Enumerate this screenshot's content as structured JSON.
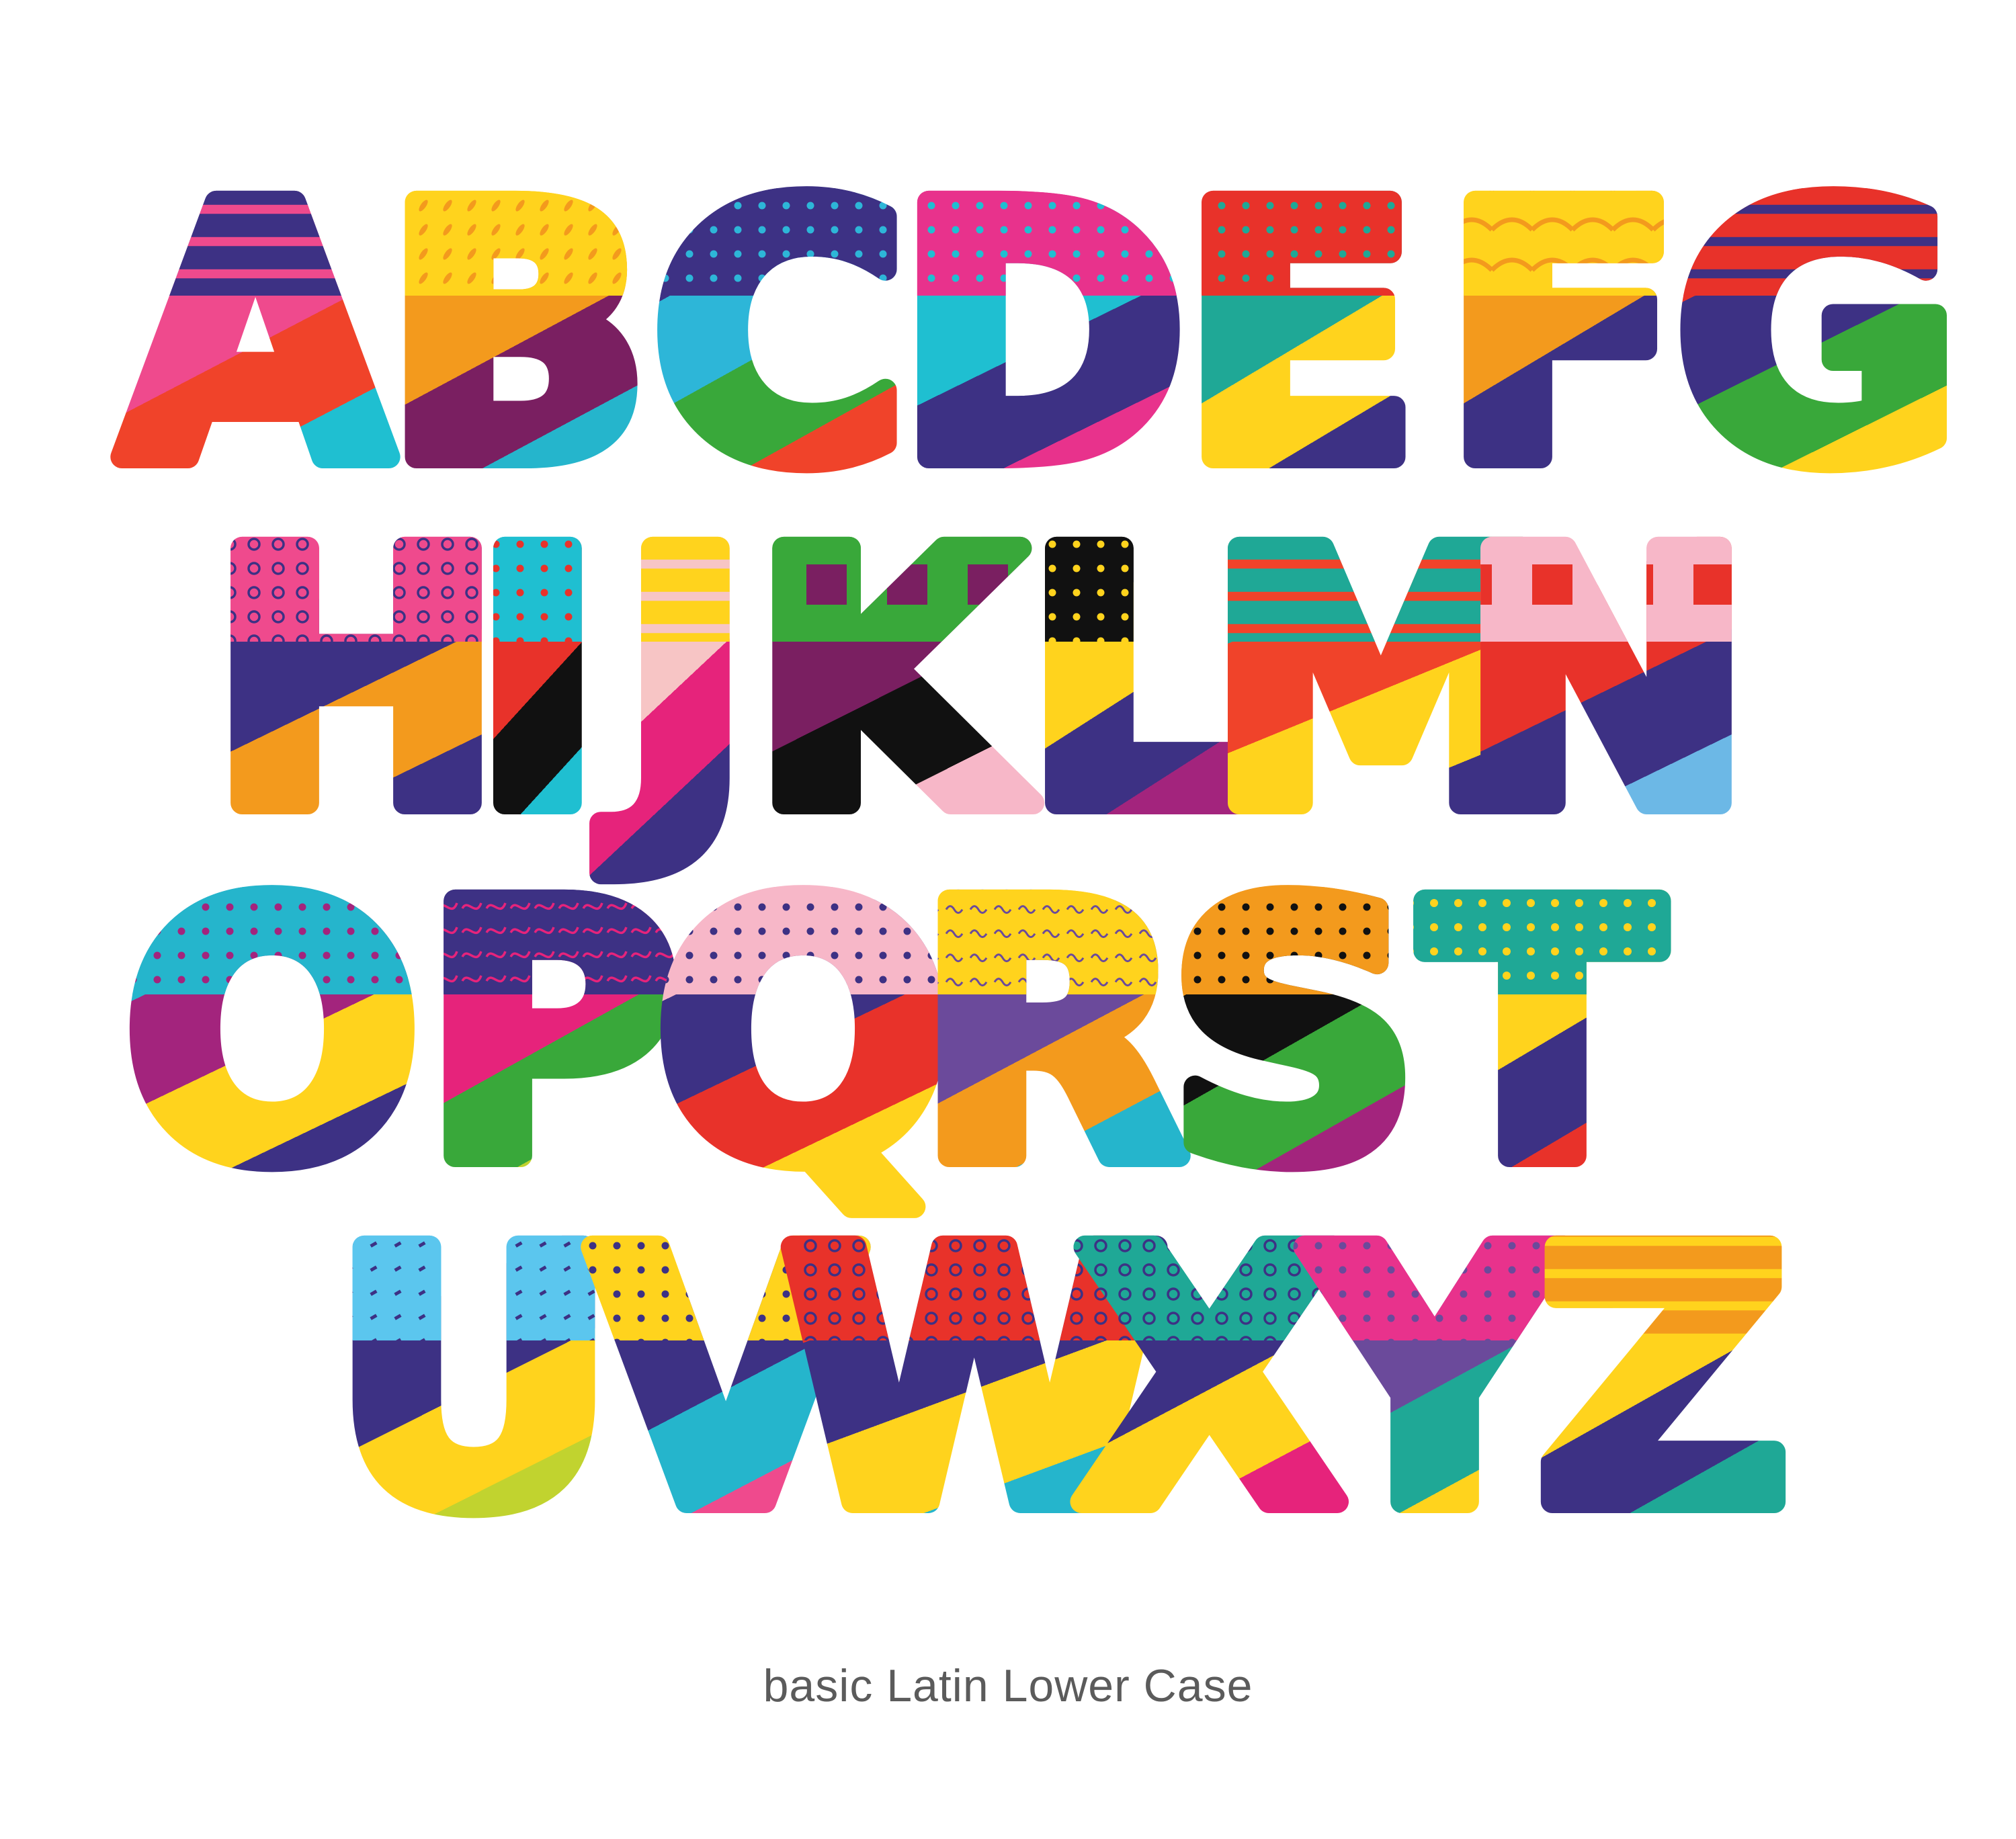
{
  "alphabet": [
    {
      "letter": "A",
      "colors": [
        "#3d3184",
        "#ef4a8d",
        "#f0432a",
        "#1fbfd1"
      ],
      "pattern": "stripes"
    },
    {
      "letter": "B",
      "colors": [
        "#ffd31d",
        "#f39a1d",
        "#7a1f61",
        "#25b5cc"
      ],
      "pattern": "leaves"
    },
    {
      "letter": "C",
      "colors": [
        "#3d3184",
        "#2db6d8",
        "#39a83a",
        "#f0432a"
      ],
      "pattern": "dots"
    },
    {
      "letter": "D",
      "colors": [
        "#e8328c",
        "#1fbfd1",
        "#3d3184",
        "#e8328c"
      ],
      "pattern": "dots"
    },
    {
      "letter": "E",
      "colors": [
        "#e8322a",
        "#1fa896",
        "#ffd31d",
        "#3d3184"
      ],
      "pattern": "dots"
    },
    {
      "letter": "F",
      "colors": [
        "#ffd31d",
        "#f39a1d",
        "#3d3184",
        "#3d3184"
      ],
      "pattern": "arcs"
    },
    {
      "letter": "G",
      "colors": [
        "#e8322a",
        "#3d3184",
        "#39a83a",
        "#ffd31d"
      ],
      "pattern": "stripes"
    },
    {
      "letter": "H",
      "colors": [
        "#ef4a8d",
        "#3d3184",
        "#f39a1d",
        "#3d3184"
      ],
      "pattern": "rings"
    },
    {
      "letter": "I",
      "colors": [
        "#1fbfd1",
        "#e8322a",
        "#111111",
        "#1fbfd1"
      ],
      "pattern": "dots"
    },
    {
      "letter": "J",
      "colors": [
        "#ffd31d",
        "#f7c5c5",
        "#e6237b",
        "#3d3184"
      ],
      "pattern": "stripes"
    },
    {
      "letter": "K",
      "colors": [
        "#39a83a",
        "#7a1f61",
        "#111111",
        "#f7b7c8"
      ],
      "pattern": "blocks"
    },
    {
      "letter": "L",
      "colors": [
        "#111111",
        "#ffd31d",
        "#3d3184",
        "#a3247d"
      ],
      "pattern": "dots"
    },
    {
      "letter": "M",
      "colors": [
        "#1fa896",
        "#f0432a",
        "#ffd31d",
        "#3d3184"
      ],
      "pattern": "stripes"
    },
    {
      "letter": "N",
      "colors": [
        "#f7b7c8",
        "#e8322a",
        "#3d3184",
        "#6cb8e6"
      ],
      "pattern": "blocks"
    },
    {
      "letter": "O",
      "colors": [
        "#25b5cc",
        "#a3247d",
        "#ffd31d",
        "#3d3184"
      ],
      "pattern": "dots"
    },
    {
      "letter": "P",
      "colors": [
        "#3d3184",
        "#e6237b",
        "#39a83a",
        "#c1d32f"
      ],
      "pattern": "scribble"
    },
    {
      "letter": "Q",
      "colors": [
        "#f7b7c8",
        "#3d3184",
        "#e8322a",
        "#ffd31d"
      ],
      "pattern": "dots"
    },
    {
      "letter": "R",
      "colors": [
        "#ffd31d",
        "#6b4a9b",
        "#f39a1d",
        "#25b5cc"
      ],
      "pattern": "squiggles"
    },
    {
      "letter": "S",
      "colors": [
        "#f39a1d",
        "#111111",
        "#39a83a",
        "#a3247d"
      ],
      "pattern": "dots"
    },
    {
      "letter": "T",
      "colors": [
        "#1fa896",
        "#ffd31d",
        "#3d3184",
        "#e8322a"
      ],
      "pattern": "blobs"
    },
    {
      "letter": "U",
      "colors": [
        "#5bc6ee",
        "#3d3184",
        "#ffd31d",
        "#c1d32f"
      ],
      "pattern": "dashes"
    },
    {
      "letter": "V",
      "colors": [
        "#ffd31d",
        "#3d3184",
        "#25b5cc",
        "#ef4a8d"
      ],
      "pattern": "dots"
    },
    {
      "letter": "W",
      "colors": [
        "#e8322a",
        "#3d3184",
        "#ffd31d",
        "#25b5cc"
      ],
      "pattern": "rings"
    },
    {
      "letter": "X",
      "colors": [
        "#1fa896",
        "#3d3184",
        "#ffd31d",
        "#e6237b"
      ],
      "pattern": "rings"
    },
    {
      "letter": "Y",
      "colors": [
        "#e8328c",
        "#6b4a9b",
        "#1fa896",
        "#ffd31d"
      ],
      "pattern": "dots"
    },
    {
      "letter": "Z",
      "colors": [
        "#f39a1d",
        "#ffd31d",
        "#3d3184",
        "#1fa896"
      ],
      "pattern": "stripes"
    }
  ],
  "caption": "basic Latin Lower Case"
}
